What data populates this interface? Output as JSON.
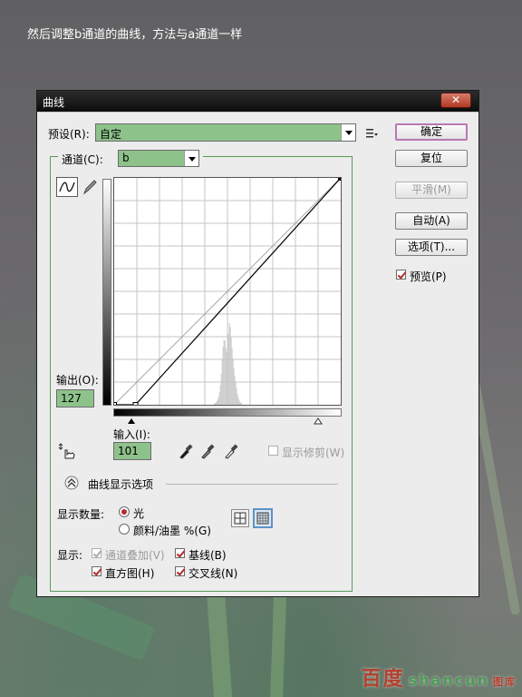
{
  "caption": "然后调整b通道的曲线，方法与a通道一样",
  "watermark": {
    "cn": "百度",
    "en": "shancun",
    "site": "图库"
  },
  "dialog": {
    "title": "曲线",
    "close": "✕",
    "preset": {
      "label": "预设(R):",
      "value": "自定"
    },
    "channel": {
      "label": "通道(C):",
      "value": "b"
    },
    "output": {
      "label": "输出(O):",
      "value": "127"
    },
    "input": {
      "label": "输入(I):",
      "value": "101"
    },
    "show_clipping": "显示修剪(W)",
    "curve_options_label": "曲线显示选项",
    "show_amount": {
      "label": "显示数量:",
      "options": [
        "光",
        "颜料/油墨 %(G)"
      ],
      "selected": 0
    },
    "show": {
      "label": "显示:",
      "options": [
        {
          "label": "通道叠加(V)",
          "checked": true,
          "disabled": true
        },
        {
          "label": "基线(B)",
          "checked": true,
          "disabled": false
        },
        {
          "label": "直方图(H)",
          "checked": true,
          "disabled": false
        },
        {
          "label": "交叉线(N)",
          "checked": true,
          "disabled": false
        }
      ]
    },
    "buttons": {
      "ok": "确定",
      "reset": "复位",
      "smooth": "平滑(M)",
      "auto": "自动(A)",
      "options": "选项(T)..."
    },
    "preview": {
      "label": "预览(P)",
      "checked": true
    }
  },
  "chart_data": {
    "type": "line",
    "title": "",
    "xlim": [
      0,
      255
    ],
    "ylim": [
      0,
      255
    ],
    "series": [
      {
        "x": [
          0,
          24,
          255
        ],
        "y": [
          0,
          0,
          255
        ]
      }
    ],
    "baseline": {
      "x": [
        0,
        255
      ],
      "y": [
        0,
        255
      ]
    },
    "selected_point": {
      "x": 101,
      "y": 127
    },
    "grid": true,
    "histogram": [
      0,
      0,
      0,
      0,
      0,
      0,
      0,
      0,
      0,
      0,
      0,
      0,
      0,
      0,
      0,
      0,
      0,
      0,
      0,
      0,
      0,
      0,
      0,
      0,
      0,
      0,
      0,
      0,
      0,
      0,
      0,
      0,
      0,
      0,
      0,
      0,
      0,
      0,
      0,
      0,
      0,
      0,
      0,
      0,
      0,
      0,
      0,
      0,
      0,
      0,
      0,
      0,
      0,
      0,
      0,
      0,
      0,
      0,
      0,
      0,
      0,
      0,
      0,
      0,
      0,
      0,
      0,
      0,
      0,
      0,
      0,
      0,
      0,
      0,
      0,
      0,
      0,
      0,
      0,
      0,
      0,
      0,
      0,
      0,
      0,
      0,
      0,
      0,
      0,
      0,
      0,
      0,
      0,
      0,
      0,
      0,
      0,
      0,
      0,
      0,
      0,
      0,
      0,
      0,
      0,
      0,
      0,
      0,
      0,
      0,
      0,
      0,
      1,
      2,
      3,
      4,
      6,
      9,
      14,
      22,
      34,
      50,
      64,
      72,
      70,
      62,
      58,
      64,
      78,
      90,
      86,
      74,
      62,
      50,
      40,
      32,
      25,
      18,
      12,
      8,
      5,
      3,
      2,
      1,
      0,
      0,
      0,
      0,
      0,
      0,
      0,
      0,
      0,
      0,
      0,
      0,
      0,
      0,
      0,
      0,
      0,
      0,
      0,
      0,
      0,
      0,
      0,
      0,
      0,
      0,
      0,
      0,
      0,
      0,
      0,
      0,
      0,
      0,
      0,
      0,
      0,
      0,
      0,
      0,
      0,
      0,
      0,
      0,
      0,
      0,
      0,
      0,
      0,
      0,
      0,
      0,
      0,
      0,
      0,
      0,
      0,
      0,
      0,
      0,
      0,
      0,
      0,
      0,
      0,
      0,
      0,
      0,
      0,
      0,
      0,
      0,
      0,
      0,
      0,
      0,
      0,
      0,
      0,
      0,
      0,
      0,
      0,
      0,
      0,
      0,
      0,
      0,
      0,
      0,
      0,
      0,
      0,
      0,
      0,
      0,
      0,
      0,
      0,
      0,
      0,
      0,
      0,
      0,
      0,
      0,
      0,
      0,
      0,
      0,
      0,
      0,
      0,
      0,
      0,
      0,
      0,
      0,
      0,
      0,
      0,
      0,
      0,
      0,
      0,
      0,
      0,
      0,
      0,
      0,
      0,
      0,
      0,
      0,
      0,
      0,
      0,
      0,
      0,
      0,
      0,
      0,
      0,
      0,
      0,
      0,
      0,
      0,
      0
    ]
  }
}
